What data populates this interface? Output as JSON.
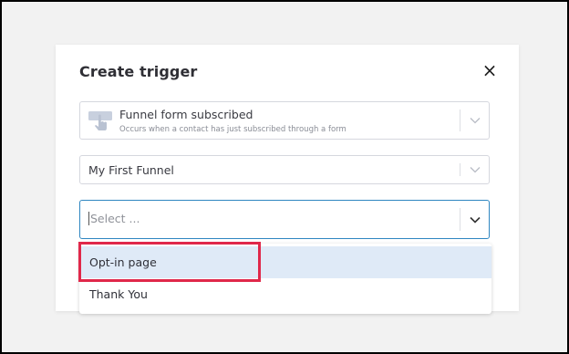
{
  "modal": {
    "title": "Create trigger",
    "close_label": "×"
  },
  "trigger_select": {
    "title": "Funnel form subscribed",
    "subtitle": "Occurs when a contact has just subscribed through a form",
    "icon": "hand-pointer-icon"
  },
  "funnel_select": {
    "value": "My First Funnel"
  },
  "page_select": {
    "placeholder": "Select ...",
    "options": [
      {
        "label": "Opt-in page"
      },
      {
        "label": "Thank You"
      }
    ]
  },
  "colors": {
    "focus_border": "#2f86c1",
    "option_highlight": "#dfeaf7",
    "annotation": "#e0284a"
  }
}
